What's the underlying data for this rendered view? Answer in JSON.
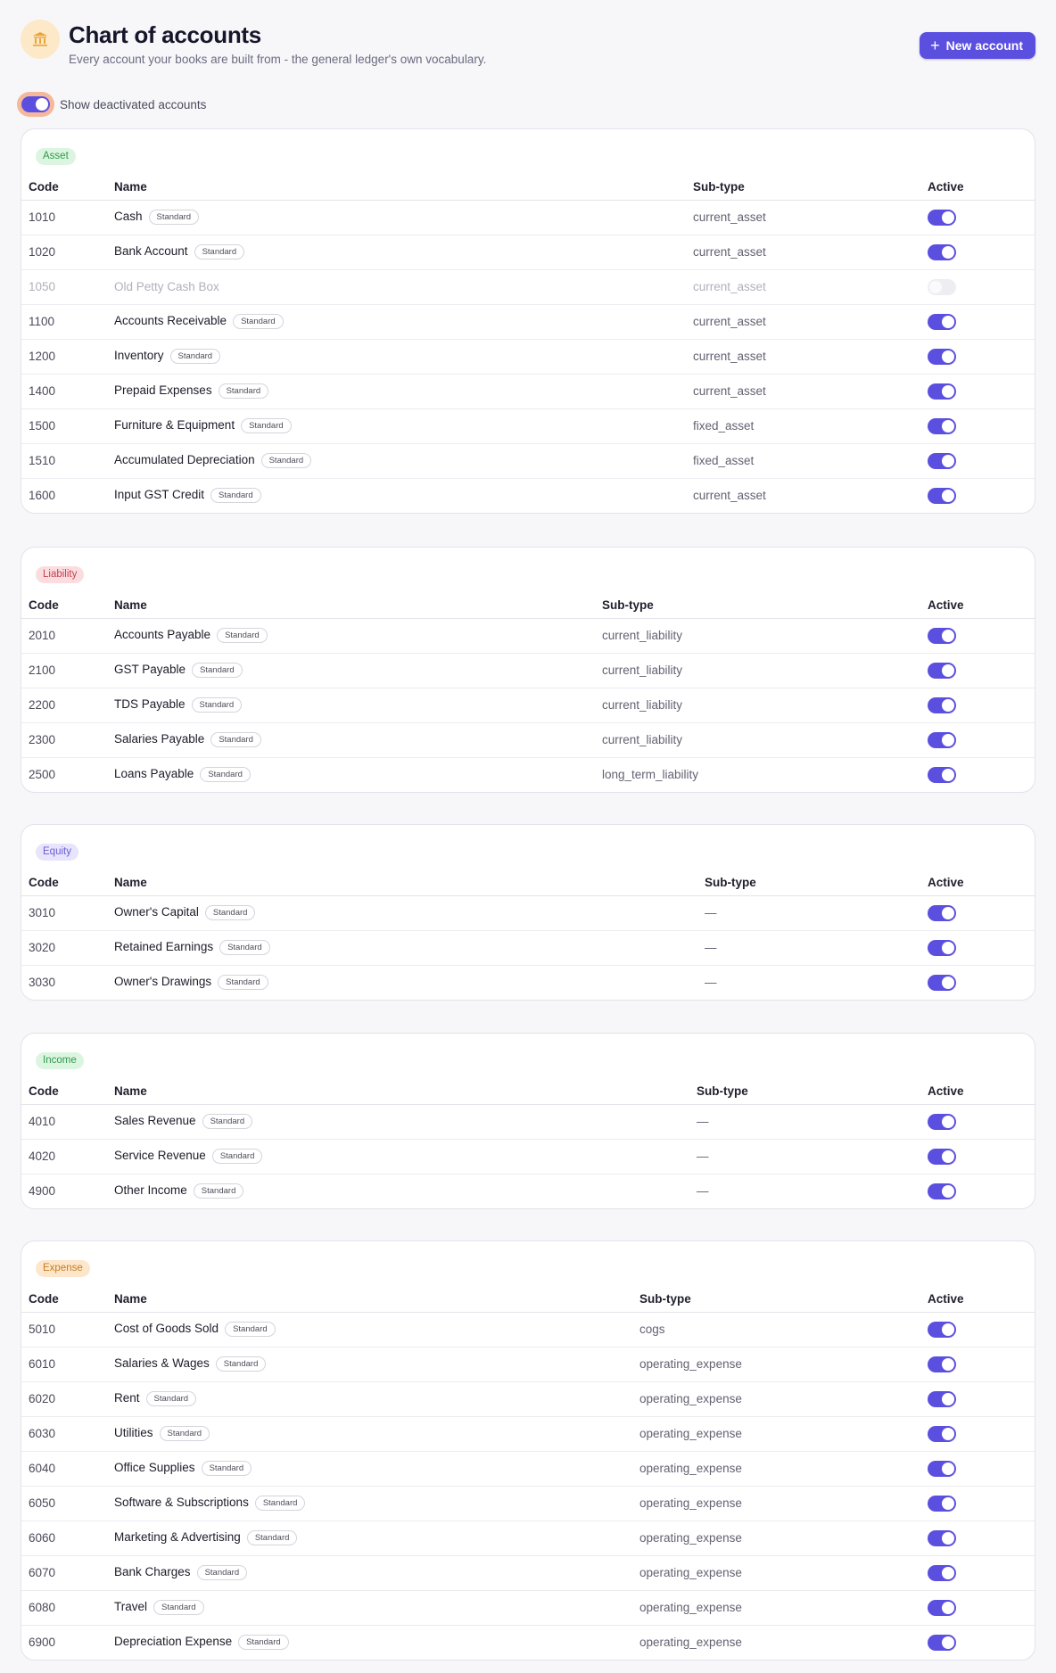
{
  "header": {
    "title": "Chart of accounts",
    "subtitle": "Every account your books are built from - the general ledger's own vocabulary.",
    "new_account_label": "New account"
  },
  "filters": {
    "show_deactivated_label": "Show deactivated accounts",
    "show_deactivated_on": true
  },
  "columns": {
    "code": "Code",
    "name": "Name",
    "subtype": "Sub-type",
    "active": "Active"
  },
  "standard_label": "Standard",
  "colors": {
    "accent": "#5b4fe0",
    "focus_ring": "#f6b89a"
  },
  "sections": [
    {
      "type": "Asset",
      "badge_bg": "#dcf5e0",
      "badge_fg": "#2f9a4a",
      "rows": [
        {
          "code": "1010",
          "name": "Cash",
          "standard": true,
          "subtype": "current_asset",
          "active": true
        },
        {
          "code": "1020",
          "name": "Bank Account",
          "standard": true,
          "subtype": "current_asset",
          "active": true
        },
        {
          "code": "1050",
          "name": "Old Petty Cash Box",
          "standard": false,
          "subtype": "current_asset",
          "active": false
        },
        {
          "code": "1100",
          "name": "Accounts Receivable",
          "standard": true,
          "subtype": "current_asset",
          "active": true
        },
        {
          "code": "1200",
          "name": "Inventory",
          "standard": true,
          "subtype": "current_asset",
          "active": true
        },
        {
          "code": "1400",
          "name": "Prepaid Expenses",
          "standard": true,
          "subtype": "current_asset",
          "active": true
        },
        {
          "code": "1500",
          "name": "Furniture & Equipment",
          "standard": true,
          "subtype": "fixed_asset",
          "active": true
        },
        {
          "code": "1510",
          "name": "Accumulated Depreciation",
          "standard": true,
          "subtype": "fixed_asset",
          "active": true
        },
        {
          "code": "1600",
          "name": "Input GST Credit",
          "standard": true,
          "subtype": "current_asset",
          "active": true
        }
      ]
    },
    {
      "type": "Liability",
      "badge_bg": "#fbdde0",
      "badge_fg": "#c8414f",
      "rows": [
        {
          "code": "2010",
          "name": "Accounts Payable",
          "standard": true,
          "subtype": "current_liability",
          "active": true
        },
        {
          "code": "2100",
          "name": "GST Payable",
          "standard": true,
          "subtype": "current_liability",
          "active": true
        },
        {
          "code": "2200",
          "name": "TDS Payable",
          "standard": true,
          "subtype": "current_liability",
          "active": true
        },
        {
          "code": "2300",
          "name": "Salaries Payable",
          "standard": true,
          "subtype": "current_liability",
          "active": true
        },
        {
          "code": "2500",
          "name": "Loans Payable",
          "standard": true,
          "subtype": "long_term_liability",
          "active": true
        }
      ]
    },
    {
      "type": "Equity",
      "badge_bg": "#e7e4fb",
      "badge_fg": "#6a5ed6",
      "rows": [
        {
          "code": "3010",
          "name": "Owner's Capital",
          "standard": true,
          "subtype": "—",
          "active": true
        },
        {
          "code": "3020",
          "name": "Retained Earnings",
          "standard": true,
          "subtype": "—",
          "active": true
        },
        {
          "code": "3030",
          "name": "Owner's Drawings",
          "standard": true,
          "subtype": "—",
          "active": true
        }
      ]
    },
    {
      "type": "Income",
      "badge_bg": "#dcf5e0",
      "badge_fg": "#2f9a4a",
      "rows": [
        {
          "code": "4010",
          "name": "Sales Revenue",
          "standard": true,
          "subtype": "—",
          "active": true
        },
        {
          "code": "4020",
          "name": "Service Revenue",
          "standard": true,
          "subtype": "—",
          "active": true
        },
        {
          "code": "4900",
          "name": "Other Income",
          "standard": true,
          "subtype": "—",
          "active": true
        }
      ]
    },
    {
      "type": "Expense",
      "badge_bg": "#fde7cc",
      "badge_fg": "#c97a1c",
      "rows": [
        {
          "code": "5010",
          "name": "Cost of Goods Sold",
          "standard": true,
          "subtype": "cogs",
          "active": true
        },
        {
          "code": "6010",
          "name": "Salaries & Wages",
          "standard": true,
          "subtype": "operating_expense",
          "active": true
        },
        {
          "code": "6020",
          "name": "Rent",
          "standard": true,
          "subtype": "operating_expense",
          "active": true
        },
        {
          "code": "6030",
          "name": "Utilities",
          "standard": true,
          "subtype": "operating_expense",
          "active": true
        },
        {
          "code": "6040",
          "name": "Office Supplies",
          "standard": true,
          "subtype": "operating_expense",
          "active": true
        },
        {
          "code": "6050",
          "name": "Software & Subscriptions",
          "standard": true,
          "subtype": "operating_expense",
          "active": true
        },
        {
          "code": "6060",
          "name": "Marketing & Advertising",
          "standard": true,
          "subtype": "operating_expense",
          "active": true
        },
        {
          "code": "6070",
          "name": "Bank Charges",
          "standard": true,
          "subtype": "operating_expense",
          "active": true
        },
        {
          "code": "6080",
          "name": "Travel",
          "standard": true,
          "subtype": "operating_expense",
          "active": true
        },
        {
          "code": "6900",
          "name": "Depreciation Expense",
          "standard": true,
          "subtype": "operating_expense",
          "active": true
        }
      ]
    }
  ]
}
